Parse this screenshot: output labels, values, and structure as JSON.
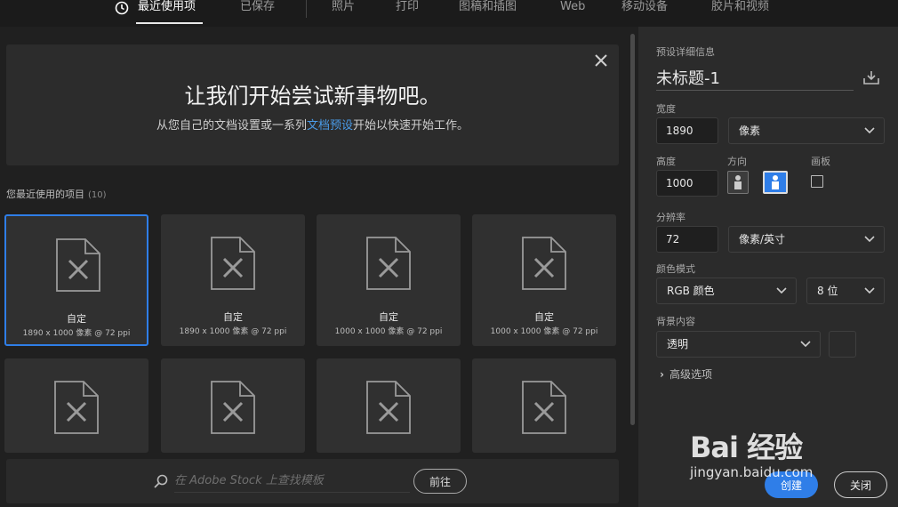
{
  "tabs": [
    {
      "label": "最近使用项",
      "active": true
    },
    {
      "label": "已保存",
      "active": false
    },
    {
      "label": "照片",
      "active": false
    },
    {
      "label": "打印",
      "active": false
    },
    {
      "label": "图稿和插图",
      "active": false
    },
    {
      "label": "Web",
      "active": false
    },
    {
      "label": "移动设备",
      "active": false
    },
    {
      "label": "胶片和视频",
      "active": false
    }
  ],
  "welcome": {
    "title": "让我们开始尝试新事物吧。",
    "sub_before": "从您自己的文档设置或一系列",
    "sub_link": "文档预设",
    "sub_after": "开始以快速开始工作。"
  },
  "recent": {
    "label": "您最近使用的项目",
    "count": "(10)",
    "items": [
      {
        "name": "自定",
        "meta": "1890 x 1000 像素 @ 72 ppi",
        "selected": true
      },
      {
        "name": "自定",
        "meta": "1890 x 1000 像素 @ 72 ppi",
        "selected": false
      },
      {
        "name": "自定",
        "meta": "1000 x 1000 像素 @ 72 ppi",
        "selected": false
      },
      {
        "name": "自定",
        "meta": "1000 x 1000 像素 @ 72 ppi",
        "selected": false
      }
    ]
  },
  "search": {
    "placeholder": "在 Adobe Stock 上查找模板",
    "go_label": "前往"
  },
  "panel": {
    "section_title": "预设详细信息",
    "doc_title": "未标题-1",
    "width_label": "宽度",
    "width_value": "1890",
    "width_unit": "像素",
    "height_label": "高度",
    "height_value": "1000",
    "orientation_label": "方向",
    "artboard_label": "画板",
    "resolution_label": "分辨率",
    "resolution_value": "72",
    "resolution_unit": "像素/英寸",
    "color_mode_label": "颜色模式",
    "color_mode_value": "RGB 颜色",
    "bit_depth_value": "8 位",
    "background_label": "背景内容",
    "background_value": "透明",
    "advanced_label": "高级选项",
    "create_label": "创建",
    "close_label": "关闭"
  },
  "watermark": {
    "brand": "Bai 经验",
    "url": "jingyan.baidu.com"
  },
  "colors": {
    "accent": "#2f7ee8",
    "link": "#4a9be8",
    "panel_bg": "#2b2b2b",
    "card_bg": "#303030"
  },
  "icons": [
    "clock-icon",
    "close-icon",
    "document-icon",
    "search-icon",
    "save-preset-icon",
    "chevron-down-icon",
    "portrait-icon",
    "landscape-icon"
  ]
}
